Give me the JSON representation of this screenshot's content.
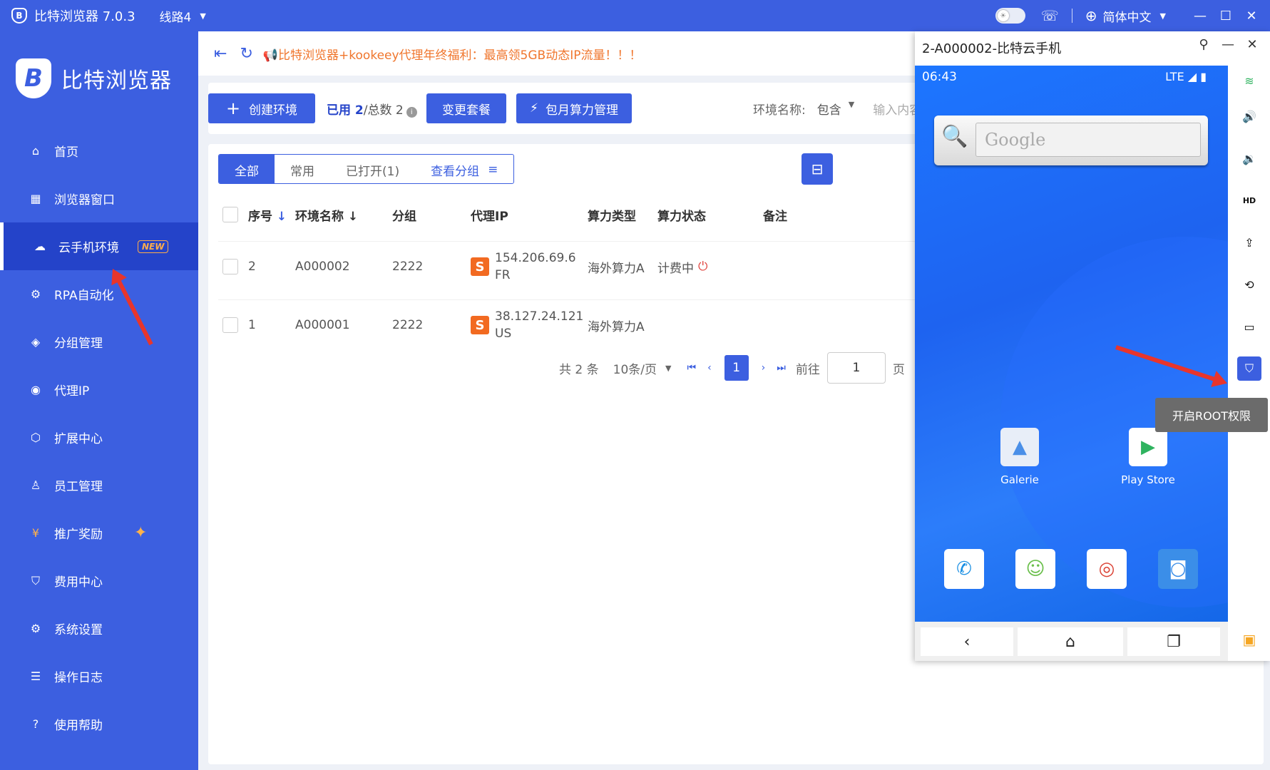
{
  "window": {
    "title": "比特浏览器 7.0.3",
    "route": "线路4",
    "language": "简体中文"
  },
  "sidebar": {
    "brand": "比特浏览器",
    "items": [
      {
        "label": "首页",
        "icon": "home-icon"
      },
      {
        "label": "浏览器窗口",
        "icon": "grid-icon"
      },
      {
        "label": "云手机环境",
        "icon": "cloud-icon",
        "badge": "NEW",
        "active": true
      },
      {
        "label": "RPA自动化",
        "icon": "robot-icon"
      },
      {
        "label": "分组管理",
        "icon": "layers-icon"
      },
      {
        "label": "代理IP",
        "icon": "location-pin-icon"
      },
      {
        "label": "扩展中心",
        "icon": "cube-icon"
      },
      {
        "label": "员工管理",
        "icon": "user-icon"
      },
      {
        "label": "推广奖励",
        "icon": "reward-icon"
      },
      {
        "label": "费用中心",
        "icon": "shield-yen-icon"
      },
      {
        "label": "系统设置",
        "icon": "settings-icon"
      },
      {
        "label": "操作日志",
        "icon": "log-icon"
      },
      {
        "label": "使用帮助",
        "icon": "help-icon"
      }
    ]
  },
  "topbar": {
    "notice": "📢比特浏览器+kookeey代理年终福利：最高领5GB动态IP流量！！！"
  },
  "toolbar": {
    "create_label": "创建环境",
    "used_prefix": "已用 ",
    "used_count": "2",
    "total_text": "/总数 2",
    "change_plan_label": "变更套餐",
    "monthly_label": "包月算力管理",
    "filter_label": "环境名称:",
    "filter_mode": "包含",
    "filter_placeholder": "输入内容搜索"
  },
  "tabs": [
    "全部",
    "常用",
    "已打开(1)",
    "查看分组"
  ],
  "table": {
    "headers": [
      "序号",
      "环境名称",
      "分组",
      "代理IP",
      "算力类型",
      "算力状态",
      "备注"
    ],
    "rows": [
      {
        "no": "2",
        "name": "A000002",
        "group": "2222",
        "ip": "154.206.69.6",
        "country": "FR",
        "type": "海外算力A",
        "status": "计费中"
      },
      {
        "no": "1",
        "name": "A000001",
        "group": "2222",
        "ip": "38.127.24.121",
        "country": "US",
        "type": "海外算力A",
        "status": ""
      }
    ]
  },
  "pagination": {
    "total": "共 2 条",
    "page_size": "10条/页",
    "current": "1",
    "goto_label": "前往",
    "goto_value": "1",
    "page_suffix": "页"
  },
  "phone": {
    "window_title": "2-A000002-比特云手机",
    "time": "06:43",
    "network": "LTE",
    "search_hint": "Google",
    "apps": [
      "Galerie",
      "Play Store"
    ],
    "tooltip": "开启ROOT权限"
  },
  "colors": {
    "primary": "#3c5fe0",
    "sidebar_active": "#2443c9",
    "notice": "#f0762d",
    "arrow": "#e8352c"
  }
}
